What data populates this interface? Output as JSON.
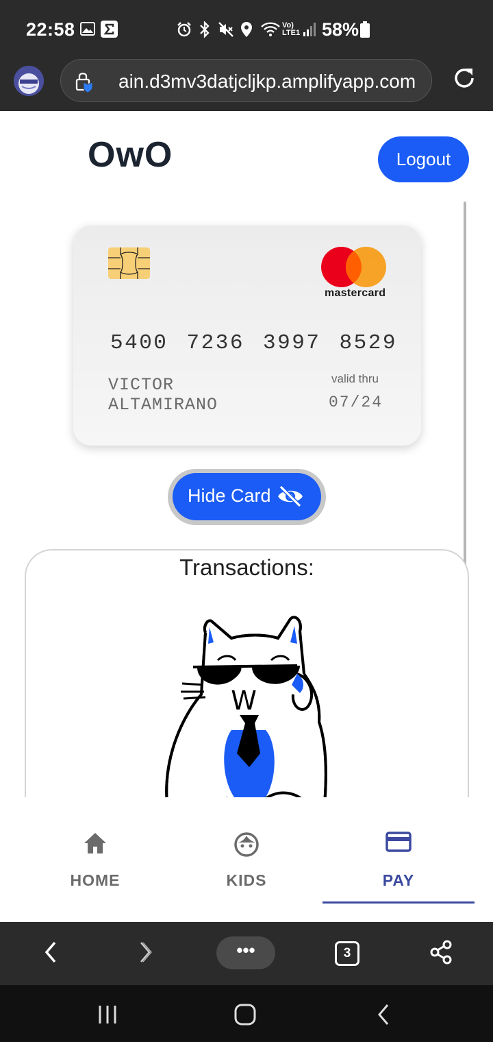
{
  "status_bar": {
    "time": "22:58",
    "battery_percent": "58%",
    "network_label": "Vo) LTE1",
    "icons": [
      "gallery-icon",
      "sigma-icon",
      "alarm-icon",
      "bluetooth-icon",
      "mute-icon",
      "location-icon",
      "wifi-icon",
      "signal-icon",
      "battery-icon"
    ]
  },
  "browser": {
    "url": "ain.d3mv3datjcljkp.amplifyapp.com",
    "tab_count": "3",
    "more_label": "•••"
  },
  "app": {
    "title": "OwO",
    "logout_label": "Logout",
    "accent_color": "#1a5cf5"
  },
  "card": {
    "brand": "mastercard",
    "number": "5400 7236 3997 8529",
    "holder_line1": "VICTOR",
    "holder_line2": "ALTAMIRANO",
    "valid_label": "valid thru",
    "valid_date": "07/24"
  },
  "hide_card": {
    "label": "Hide Card"
  },
  "transactions": {
    "title": "Transactions:",
    "illustration_letter": "W"
  },
  "bottom_nav": {
    "items": [
      {
        "label": "HOME",
        "icon": "home-icon"
      },
      {
        "label": "KIDS",
        "icon": "face-icon"
      },
      {
        "label": "PAY",
        "icon": "credit-card-icon"
      }
    ],
    "active": "PAY"
  }
}
